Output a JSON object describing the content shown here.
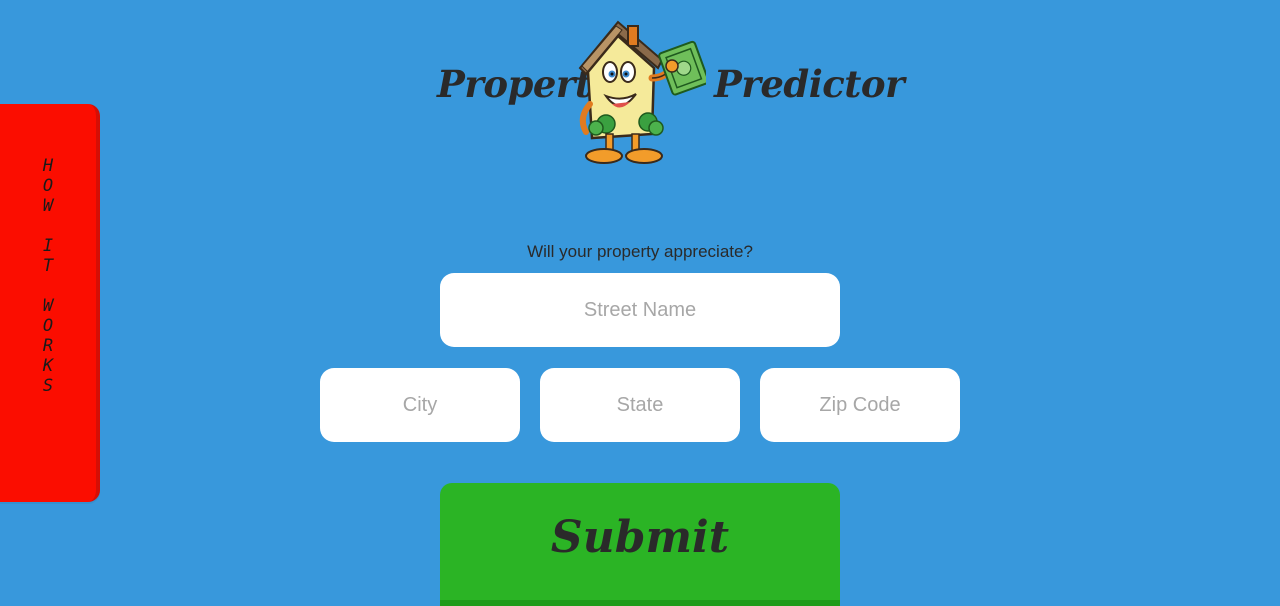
{
  "side_tab": {
    "label": "HOW IT WORKS",
    "color": "#fb0d00"
  },
  "brand": {
    "word_left": "Property",
    "word_right": "Predictor",
    "mascot_icon": "house-mascot-holding-money"
  },
  "form": {
    "tagline": "Will your property appreciate?",
    "street_placeholder": "Street Name",
    "city_placeholder": "City",
    "state_placeholder": "State",
    "zip_placeholder": "Zip Code",
    "submit_label": "Submit"
  },
  "colors": {
    "background": "#3898dc",
    "submit": "#2bb425",
    "side_tab": "#fb0d00"
  }
}
